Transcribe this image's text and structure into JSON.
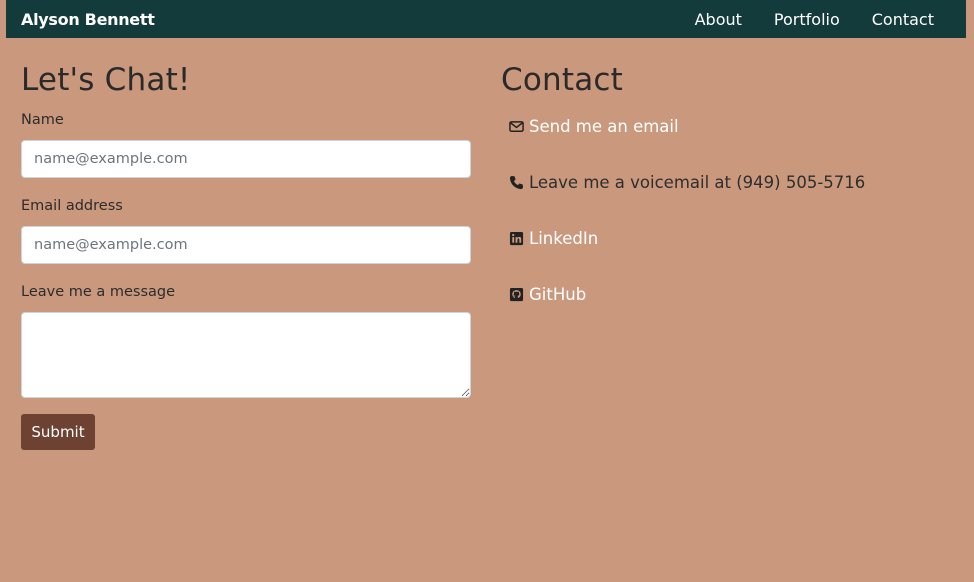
{
  "navbar": {
    "brand": "Alyson Bennett",
    "links": [
      "About",
      "Portfolio",
      "Contact"
    ]
  },
  "form": {
    "title": "Let's Chat!",
    "name_label": "Name",
    "name_placeholder": "name@example.com",
    "email_label": "Email address",
    "email_placeholder": "name@example.com",
    "message_label": "Leave me a message",
    "submit_label": "Submit"
  },
  "contact": {
    "title": "Contact",
    "email_link": "Send me an email",
    "phone_text": "Leave me a voicemail at (949) 505-5716",
    "linkedin_link": "LinkedIn",
    "github_link": "GitHub"
  },
  "icons": {
    "email": "envelope-icon",
    "phone": "phone-icon",
    "linkedin": "linkedin-icon",
    "github": "github-icon"
  },
  "colors": {
    "background": "#ca987d",
    "navbar": "#133b3c",
    "button": "#6e4233"
  }
}
